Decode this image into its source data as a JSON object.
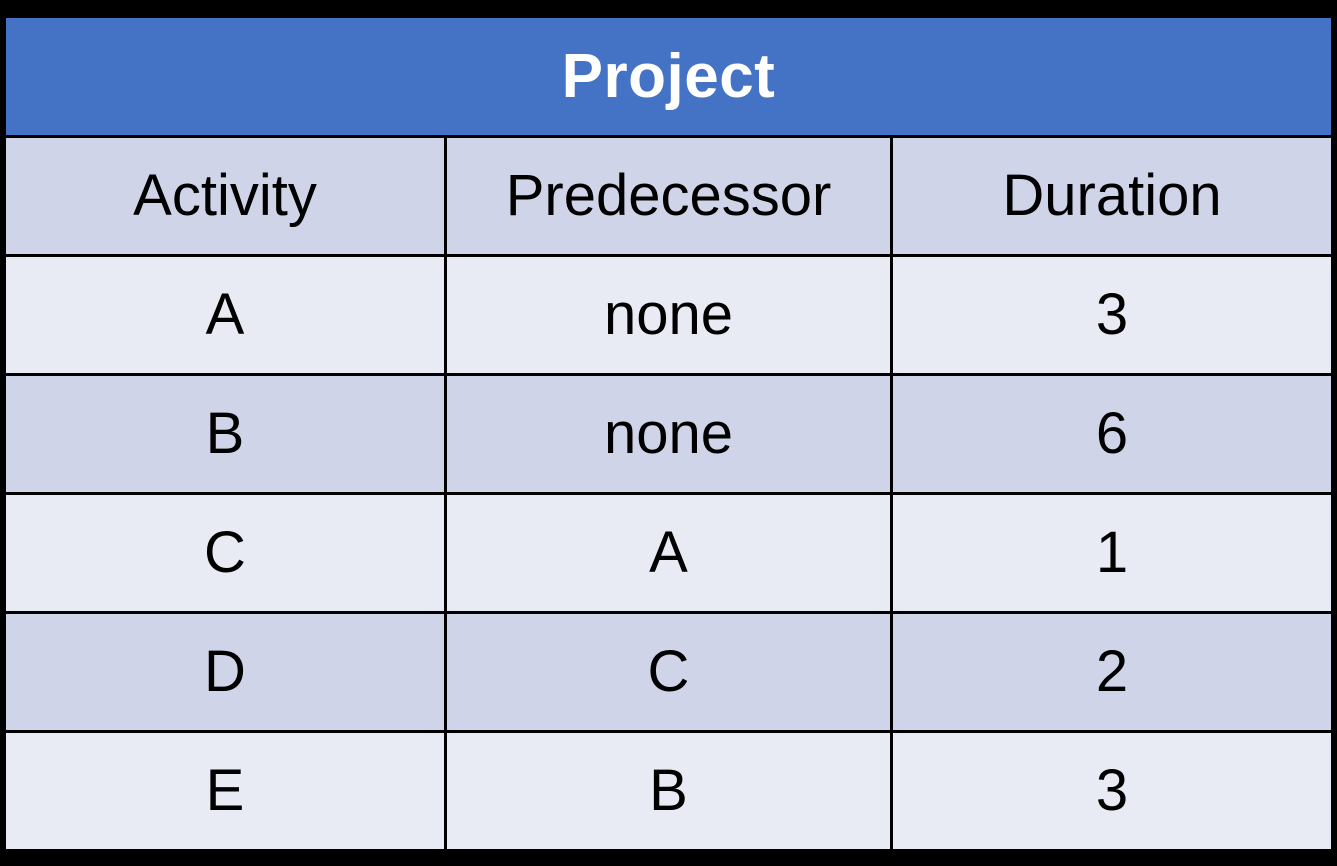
{
  "table": {
    "title": "Project",
    "columns": [
      "Activity",
      "Predecessor",
      "Duration"
    ],
    "rows": [
      {
        "activity": "A",
        "predecessor": "none",
        "duration": "3"
      },
      {
        "activity": "B",
        "predecessor": "none",
        "duration": "6"
      },
      {
        "activity": "C",
        "predecessor": "A",
        "duration": "1"
      },
      {
        "activity": "D",
        "predecessor": "C",
        "duration": "2"
      },
      {
        "activity": "E",
        "predecessor": "B",
        "duration": "3"
      }
    ],
    "colors": {
      "title_background": "#4472C4",
      "title_text": "#FFFFFF",
      "header_background": "#D0D4E8",
      "row_light": "#E8EAF4",
      "row_dark": "#D0D4E8",
      "grid_line": "#000000",
      "page_background": "#000000"
    }
  }
}
